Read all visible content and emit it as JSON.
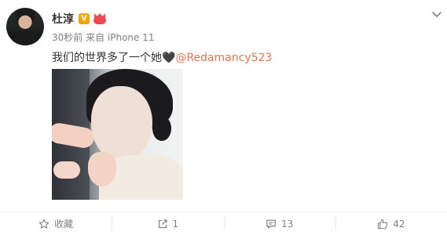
{
  "post": {
    "author": {
      "name": "杜淳",
      "verified_badge": "V"
    },
    "meta": "30秒前 来自 iPhone 11",
    "text": "我们的世界多了一个她",
    "heart_emoji": "🖤",
    "mention": "@Redamancy523"
  },
  "toolbar": {
    "favorite_label": "收藏",
    "repost_count": "1",
    "comment_count": "13",
    "like_count": "42"
  },
  "icons": {
    "menu": "chevron-down-icon",
    "favorite": "star-icon",
    "repost": "repost-icon",
    "comment": "comment-icon",
    "like": "thumbs-up-icon"
  },
  "colors": {
    "mention": "#eb7350",
    "verified": "#f7a400",
    "vip": "#f0484d",
    "muted": "#808080"
  }
}
